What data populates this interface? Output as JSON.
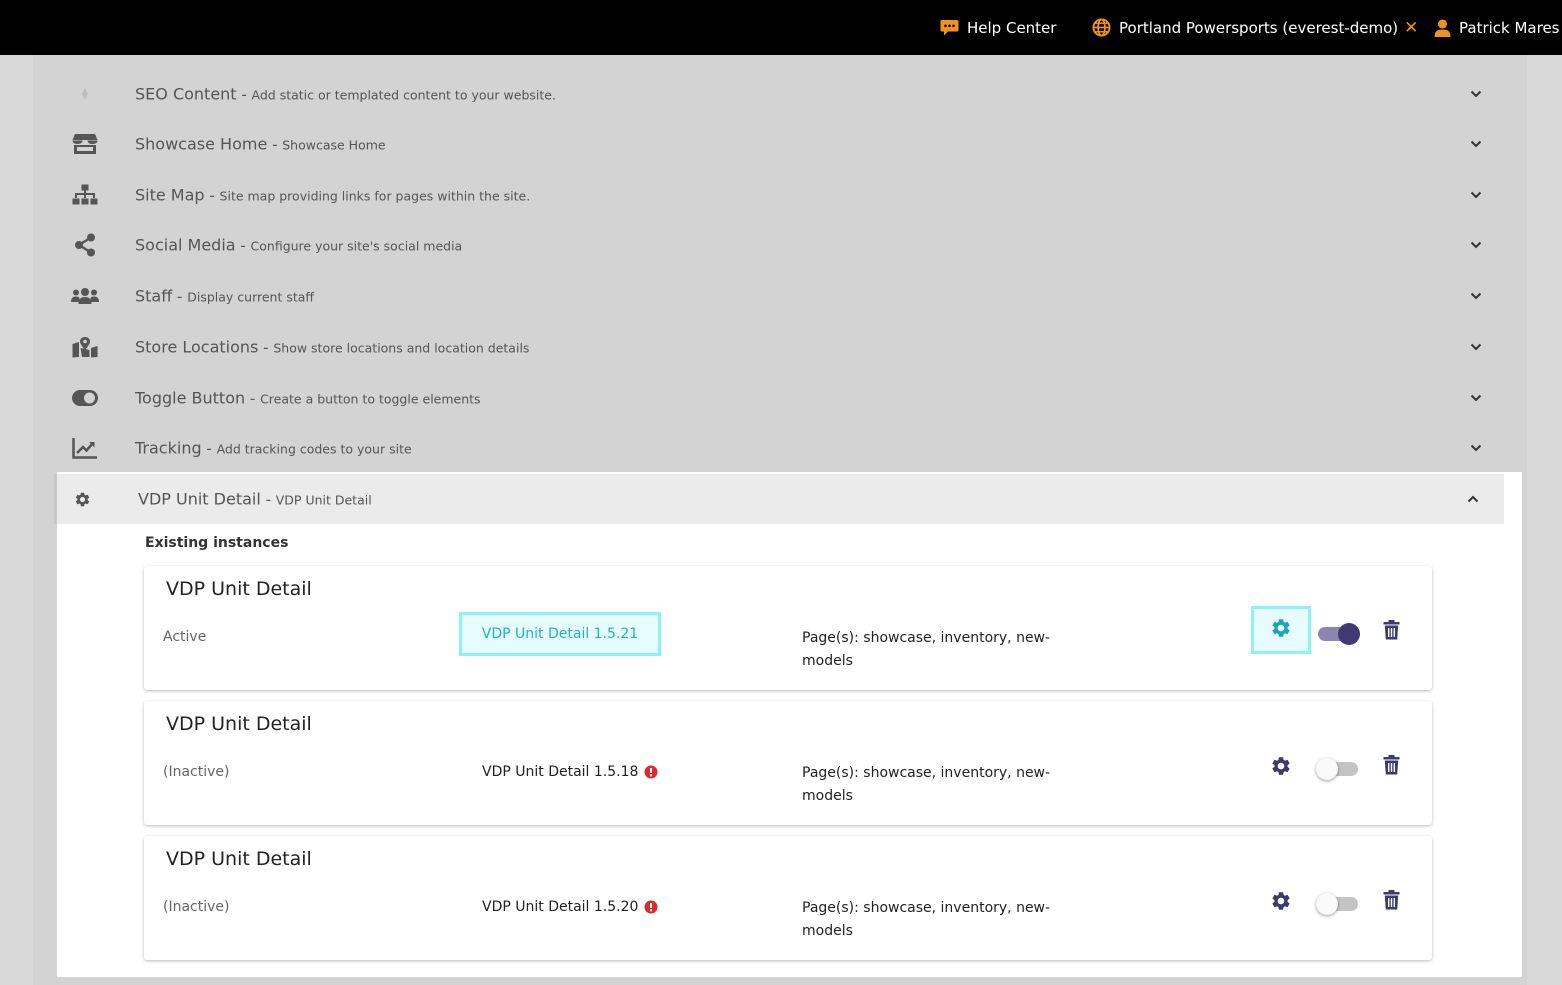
{
  "topbar": {
    "help_label": "Help Center",
    "site_label": "Portland Powersports (everest-demo)",
    "close_symbol": "✕",
    "user_label": "Patrick Mares",
    "accent_color": "#f0921f"
  },
  "modules": [
    {
      "title": "SEO Content",
      "sep": " - ",
      "desc": "Add static or templated content to your website.",
      "icon": "diamond-icon"
    },
    {
      "title": "Showcase Home",
      "sep": " - ",
      "desc": "Showcase Home",
      "icon": "store-icon"
    },
    {
      "title": "Site Map",
      "sep": " - ",
      "desc": "Site map providing links for pages within the site.",
      "icon": "sitemap-icon"
    },
    {
      "title": "Social Media",
      "sep": " - ",
      "desc": "Configure your site's social media",
      "icon": "share-icon"
    },
    {
      "title": "Staff",
      "sep": " - ",
      "desc": "Display current staff",
      "icon": "users-icon"
    },
    {
      "title": "Store Locations",
      "sep": " - ",
      "desc": "Show store locations and location details",
      "icon": "map-marked-icon"
    },
    {
      "title": "Toggle Button",
      "sep": " - ",
      "desc": "Create a button to toggle elements",
      "icon": "toggle-icon"
    },
    {
      "title": "Tracking",
      "sep": " - ",
      "desc": "Add tracking codes to your site",
      "icon": "chart-line-icon"
    },
    {
      "title": "VDP Unit Detail",
      "sep": " - ",
      "desc": "VDP Unit Detail",
      "icon": "gear-icon",
      "expanded": true
    }
  ],
  "existing": {
    "heading": "Existing instances",
    "instances": [
      {
        "title": "VDP Unit Detail",
        "status": "Active",
        "version": "VDP Unit Detail 1.5.21",
        "warning": false,
        "pages": "Page(s): showcase, inventory, new-models",
        "enabled": true
      },
      {
        "title": "VDP Unit Detail",
        "status": "(Inactive)",
        "version": "VDP Unit Detail 1.5.18",
        "warning": true,
        "pages": "Page(s): showcase, inventory, new-models",
        "enabled": false
      },
      {
        "title": "VDP Unit Detail",
        "status": "(Inactive)",
        "version": "VDP Unit Detail 1.5.20",
        "warning": true,
        "pages": "Page(s): showcase, inventory, new-models",
        "enabled": false
      }
    ]
  }
}
